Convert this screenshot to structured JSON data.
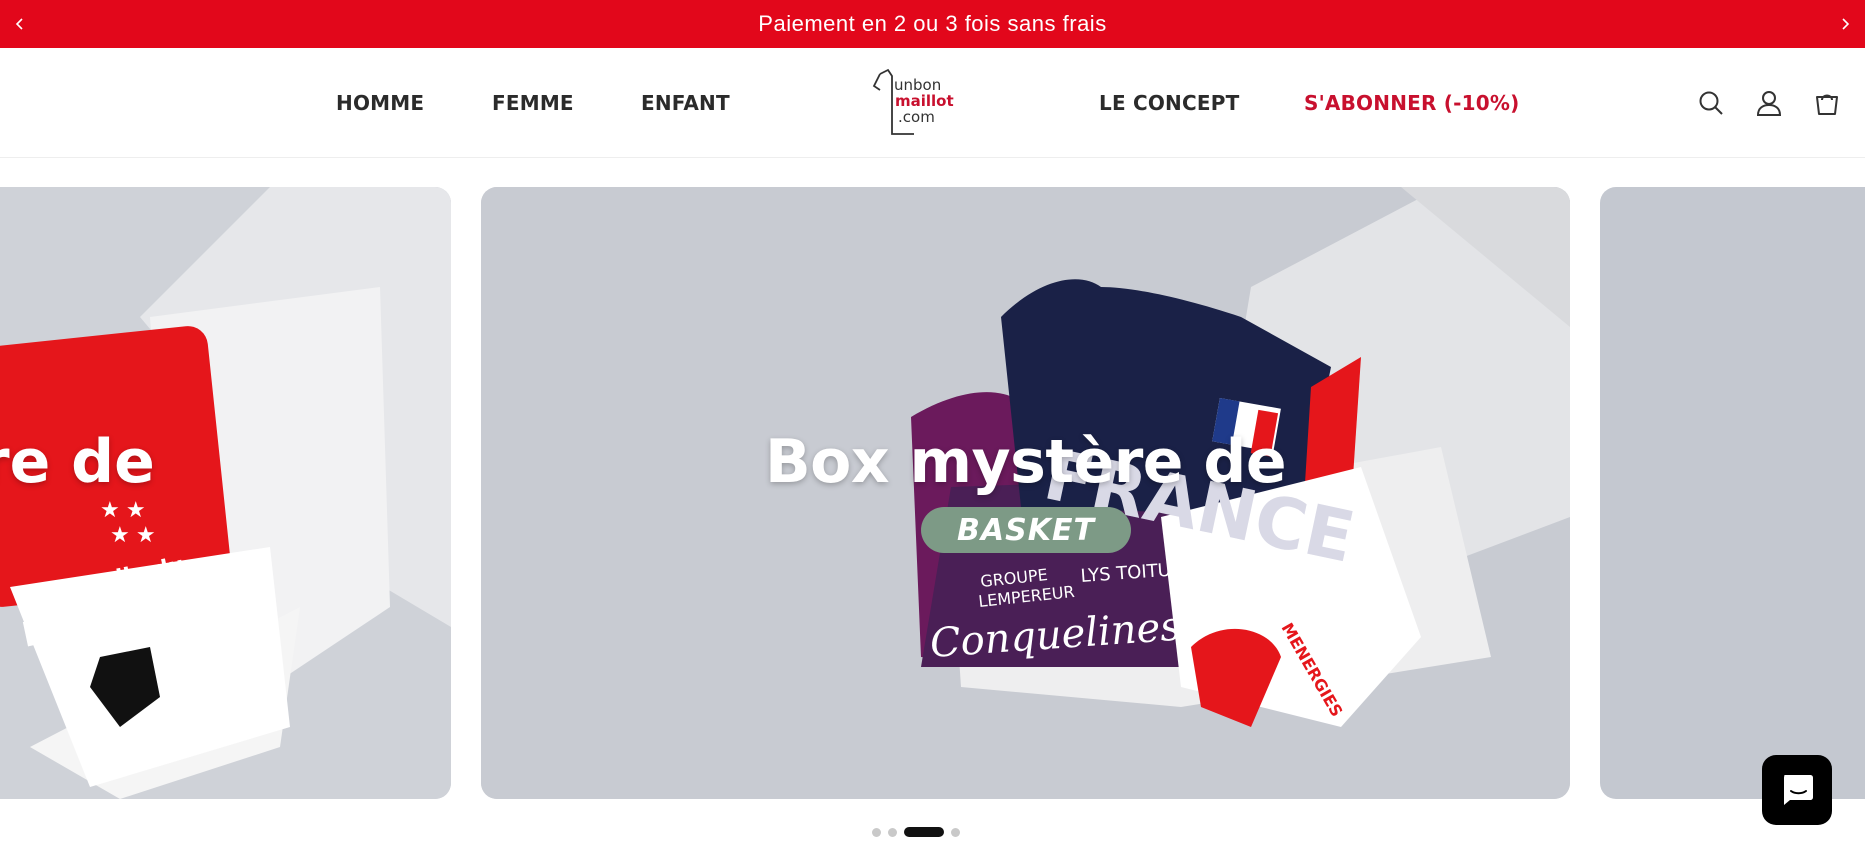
{
  "announcement": {
    "text": "Paiement en 2 ou 3 fois sans frais",
    "prev_icon": "chevron-left-icon",
    "next_icon": "chevron-right-icon",
    "background": "#e2071b"
  },
  "header": {
    "nav_left": [
      {
        "label": "HOMME"
      },
      {
        "label": "FEMME"
      },
      {
        "label": "ENFANT"
      }
    ],
    "logo": {
      "line1": "unbon",
      "line2": "maillot",
      "line3": ".com"
    },
    "nav_right": [
      {
        "label": "LE CONCEPT"
      },
      {
        "label": "S'ABONNER (-10%)",
        "accent": true
      }
    ],
    "icons": [
      "search-icon",
      "account-icon",
      "cart-icon"
    ],
    "accent_color": "#c8102e"
  },
  "carousel": {
    "left_slide": {
      "heading": "re de"
    },
    "main_slide": {
      "heading": "Box mystère de",
      "tag": "BASKET",
      "tag_color": "#7d9a86"
    },
    "dots": {
      "count": 4,
      "active_index": 2
    }
  },
  "chat": {
    "icon": "chat-bubble-icon"
  }
}
